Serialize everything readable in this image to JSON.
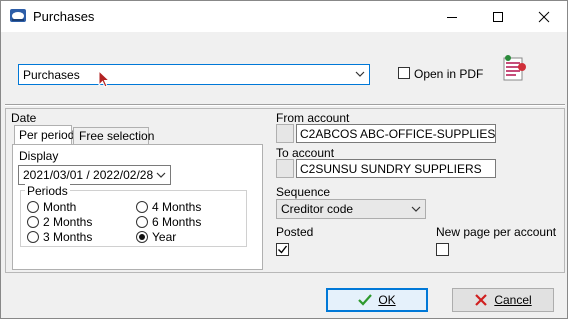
{
  "window": {
    "title": "Purchases"
  },
  "report_select": {
    "value": "Purchases"
  },
  "open_in_pdf": {
    "label": "Open in PDF",
    "checked": false
  },
  "date": {
    "label": "Date",
    "tabs": [
      {
        "label": "Per period",
        "active": true
      },
      {
        "label": "Free selection",
        "active": false
      }
    ],
    "display_label": "Display",
    "display_value": "2021/03/01 / 2022/02/28",
    "periods_label": "Periods",
    "periods": [
      {
        "label": "Month",
        "selected": false
      },
      {
        "label": "4 Months",
        "selected": false
      },
      {
        "label": "2 Months",
        "selected": false
      },
      {
        "label": "6 Months",
        "selected": false
      },
      {
        "label": "3 Months",
        "selected": false
      },
      {
        "label": "Year",
        "selected": true
      }
    ]
  },
  "from_account": {
    "label": "From account",
    "value": "C2ABCOS ABC-OFFICE-SUPPLIES"
  },
  "to_account": {
    "label": "To account",
    "value": "C2SUNSU SUNDRY SUPPLIERS"
  },
  "sequence": {
    "label": "Sequence",
    "value": "Creditor code"
  },
  "posted": {
    "label": "Posted",
    "checked": true
  },
  "new_page": {
    "label": "New page per account",
    "checked": false
  },
  "buttons": {
    "ok": "OK",
    "cancel": "Cancel"
  }
}
